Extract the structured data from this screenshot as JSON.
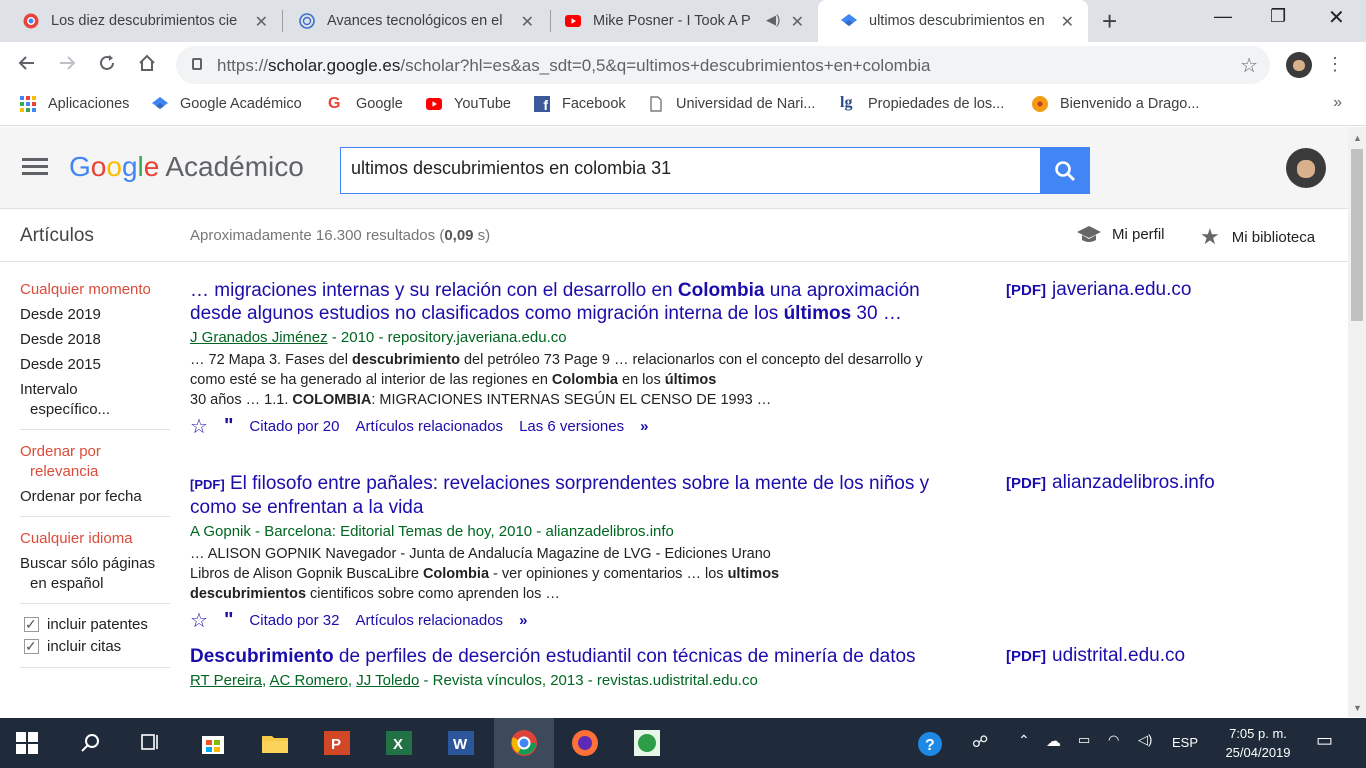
{
  "tabs": [
    {
      "title": "Los diez descubrimientos cie",
      "close": "✕"
    },
    {
      "title": "Avances tecnológicos en el á",
      "close": "✕"
    },
    {
      "title": "Mike Posner - I Took A P",
      "close": "✕"
    },
    {
      "title": "ultimos descubrimientos en",
      "close": "✕"
    }
  ],
  "new_tab": "+",
  "window_controls": {
    "minimize": "—",
    "restore": "❐",
    "close": "✕"
  },
  "address_bar": {
    "url_prefix": "https://",
    "url_host": "scholar.google.es",
    "url_path": "/scholar?hl=es&as_sdt=0,5&q=ultimos+descubrimientos+en+colombia"
  },
  "bookmarks": [
    {
      "label": "Aplicaciones",
      "icon": "apps-grid-icon"
    },
    {
      "label": "Google Académico",
      "icon": "scholar-icon"
    },
    {
      "label": "Google",
      "icon": "google-icon"
    },
    {
      "label": "YouTube",
      "icon": "youtube-icon"
    },
    {
      "label": "Facebook",
      "icon": "facebook-icon"
    },
    {
      "label": "Universidad de Nari...",
      "icon": "page-icon"
    },
    {
      "label": "Propiedades de los...",
      "icon": "lg-icon"
    },
    {
      "label": "Bienvenido a Drago...",
      "icon": "dragon-ball-icon"
    }
  ],
  "bookmarks_more": "»",
  "scholar": {
    "logo_google": "Google",
    "logo_academico": "Académico",
    "search_value": "ultimos descubrimientos en colombia 31"
  },
  "subbar": {
    "articles": "Artículos",
    "results_prefix": "Aproximadamente 16.300 resultados (",
    "results_time": "0,09",
    "results_suffix": " s)",
    "my_profile": "Mi perfil",
    "my_library": "Mi biblioteca"
  },
  "sidebar": {
    "time_selected": "Cualquier momento",
    "since_2019": "Desde 2019",
    "since_2018": "Desde 2018",
    "since_2015": "Desde 2015",
    "custom_range_1": "Intervalo",
    "custom_range_2": "específico...",
    "sort_relevance_1": "Ordenar por",
    "sort_relevance_2": "relevancia",
    "sort_date": "Ordenar por fecha",
    "lang_any": "Cualquier idioma",
    "lang_es_1": "Buscar sólo páginas",
    "lang_es_2": "en español",
    "include_patents": "incluir patentes",
    "include_citations": "incluir citas"
  },
  "results": [
    {
      "title_a": "… migraciones internas y su relación con el desarrollo en ",
      "title_b": "Colombia",
      "title_c": " una aproximación desde algunos estudios no clasificados como migración interna de los ",
      "title_d": "últimos",
      "title_e": " 30 …",
      "author": "J Granados Jiménez",
      "meta": " - 2010 - repository.javeriana.edu.co",
      "s1a": "… 72 Mapa 3. Fases del ",
      "s1b": "descubrimiento",
      "s1c": " del petróleo 73 Page 9 … relacionarlos con el concepto del desarrollo y como esté se ha generado al interior de las regiones en ",
      "s1d": "Colombia",
      "s1e": " en los ",
      "s1f": "últimos",
      "s2a": "30 años … 1.1. ",
      "s2b": "COLOMBIA",
      "s2c": ": MIGRACIONES INTERNAS SEGÚN EL CENSO DE 1993 …",
      "cited": "Citado por 20",
      "related": "Artículos relacionados",
      "versions": "Las 6 versiones",
      "side_pdf": "[PDF]",
      "side_host": "javeriana.edu.co"
    },
    {
      "pdf_tag": "[PDF]",
      "title": "El filosofo entre pañales: revelaciones sorprendentes sobre la mente de los niños y como se enfrentan a la vida",
      "meta": "A Gopnik - Barcelona: Editorial Temas de hoy, 2010 - alianzadelibros.info",
      "s1": "… ALISON GOPNIK Navegador - Junta de Andalucía Magazine de LVG - Ediciones Urano",
      "s2a": "Libros de Alison Gopnik BuscaLibre ",
      "s2b": "Colombia",
      "s2c": " - ver opiniones y comentarios … los ",
      "s2d": "ultimos",
      "s3a": "descubrimientos",
      "s3b": " cientificos sobre como aprenden los …",
      "cited": "Citado por 32",
      "related": "Artículos relacionados",
      "side_pdf": "[PDF]",
      "side_host": "alianzadelibros.info"
    },
    {
      "title_a": "Descubrimiento",
      "title_b": " de perfiles de deserción estudiantil con técnicas de minería de datos",
      "author1": "RT Pereira",
      "author2": "AC Romero",
      "author3": "JJ Toledo",
      "meta": " - Revista vínculos, 2013 - revistas.udistrital.edu.co",
      "side_pdf": "[PDF]",
      "side_host": "udistrital.edu.co"
    }
  ],
  "taskbar": {
    "lang": "ESP",
    "time": "7:05 p. m.",
    "date": "25/04/2019"
  },
  "colors": {
    "link": "#1a0dab",
    "green": "#006621",
    "accent_red": "#dd4b39",
    "search_blue": "#4285f4"
  }
}
